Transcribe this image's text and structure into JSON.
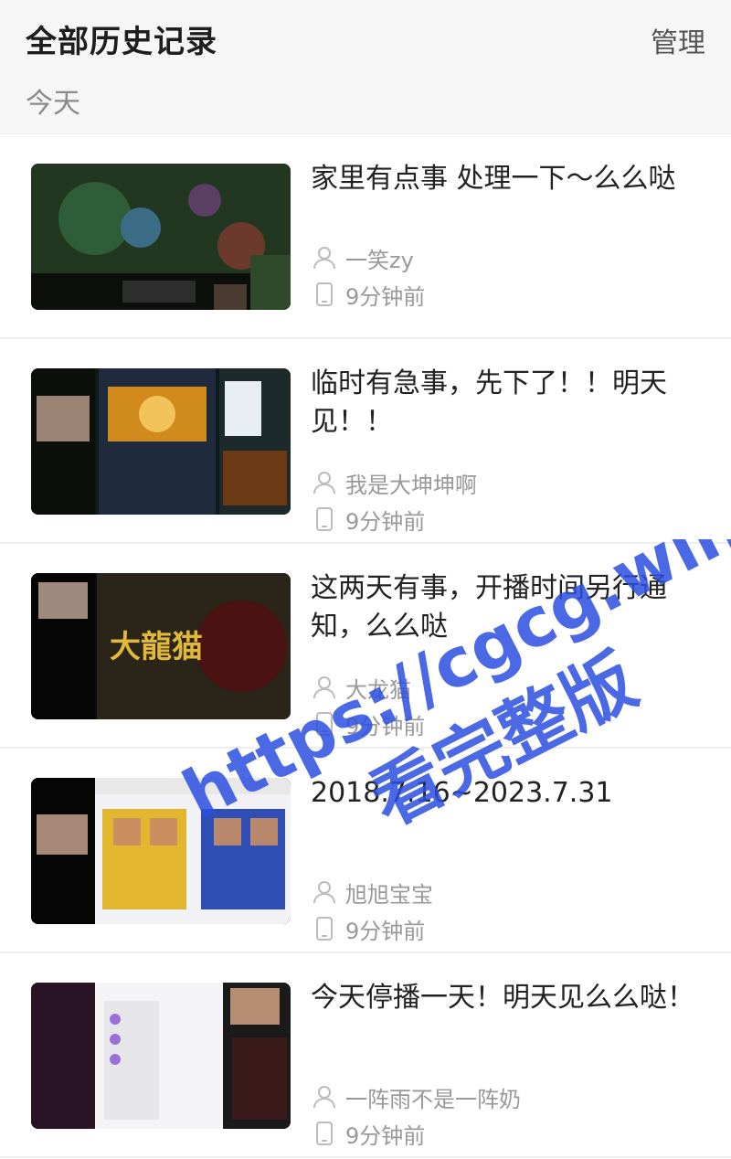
{
  "header": {
    "title": "全部历史记录",
    "manage_label": "管理",
    "section_label": "今天"
  },
  "items": [
    {
      "title": "家里有点事 处理一下～么么哒",
      "user": "一笑zy",
      "time": "9分钟前"
    },
    {
      "title": "临时有急事，先下了！！明天见！！",
      "user": "我是大坤坤啊",
      "time": "9分钟前"
    },
    {
      "title": "这两天有事，开播时间另行通知，么么哒",
      "user": "大龙猫",
      "time": "9分钟前",
      "thumb_text": "大龍猫"
    },
    {
      "title": "2018.7.16~2023.7.31",
      "user": "旭旭宝宝",
      "time": "9分钟前"
    },
    {
      "title": "今天停播一天！明天见么么哒！",
      "user": "一阵雨不是一阵奶",
      "time": "9分钟前"
    }
  ],
  "watermark": {
    "url_text": "https://cgcg.win",
    "tag_text": "看完整版",
    "color": "#2b4fe0"
  },
  "icons": {
    "user": "user-icon",
    "device": "phone-icon"
  }
}
